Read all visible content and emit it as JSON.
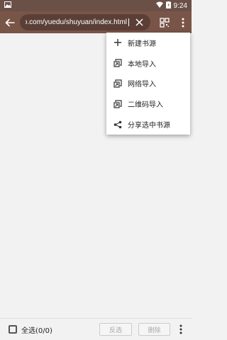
{
  "status_bar": {
    "time": "9:24",
    "icons": [
      "image-icon",
      "wifi-icon",
      "battery-icon"
    ]
  },
  "toolbar": {
    "url": "https://www.yuedu.wang/shuyuan/index.html",
    "url_visible": "ıceo.com/yuedu/shuyuan/index.html",
    "back_icon": "arrow-left-icon",
    "clear_icon": "close-icon",
    "qr_icon": "qr-scan-icon",
    "more_icon": "more-vert-icon"
  },
  "menu": {
    "items": [
      {
        "label": "新建书源",
        "icon": "plus-icon"
      },
      {
        "label": "本地导入",
        "icon": "import-icon"
      },
      {
        "label": "网络导入",
        "icon": "import-icon"
      },
      {
        "label": "二维码导入",
        "icon": "import-icon"
      },
      {
        "label": "分享选中书源",
        "icon": "share-icon"
      }
    ]
  },
  "bottom_bar": {
    "select_all_label": "全选(0/0)",
    "invert_label": "反选",
    "delete_label": "删除"
  },
  "colors": {
    "primary": "#795548",
    "status": "#6b5047",
    "url_field": "#5b3f37",
    "background": "#f2f2f2"
  }
}
